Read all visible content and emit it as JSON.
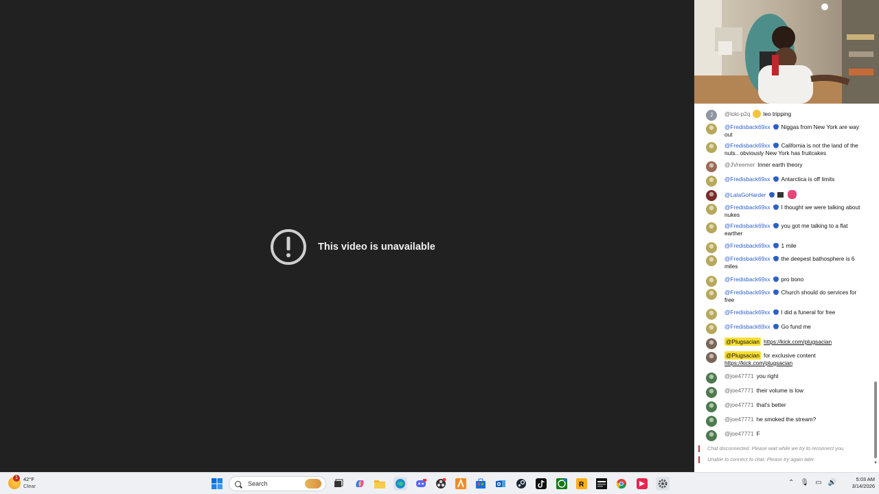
{
  "video": {
    "unavailable_message": "This video is unavailable"
  },
  "chat": {
    "messages": [
      {
        "user": "@loki-p2q",
        "text": "leo tripping",
        "style": "plain",
        "avatar": "J",
        "emoji": "laughing"
      },
      {
        "user": "@Fredisback69xx",
        "text": "Niggas from New York are way out",
        "style": "verified"
      },
      {
        "user": "@Fredisback69xx",
        "text": "California is not the land of the nuts.. obviously New York has fruitcakes",
        "style": "verified"
      },
      {
        "user": "@JVreemer",
        "text": "Inner earth theory",
        "style": "plain"
      },
      {
        "user": "@Fredisback69xx",
        "text": "Antarctica is off limits",
        "style": "verified"
      },
      {
        "user": "@LalaGoHarder",
        "text": "",
        "style": "verified",
        "emoji": "waving-hand"
      },
      {
        "user": "@Fredisback69xx",
        "text": "I thought we were talking about nukes",
        "style": "verified"
      },
      {
        "user": "@Fredisback69xx",
        "text": "you got me talking to a flat earther",
        "style": "verified"
      },
      {
        "user": "@Fredisback69xx",
        "text": "1 mile",
        "style": "verified"
      },
      {
        "user": "@Fredisback69xx",
        "text": "the deepest bathosphere is 6 miles",
        "style": "verified"
      },
      {
        "user": "@Fredisback69xx",
        "text": "pro bono",
        "style": "verified"
      },
      {
        "user": "@Fredisback69xx",
        "text": "Church should do services for free",
        "style": "verified"
      },
      {
        "user": "@Fredisback69xx",
        "text": "I did a funeral for free",
        "style": "verified"
      },
      {
        "user": "@Fredisback69xx",
        "text": "Go fund me",
        "style": "verified"
      },
      {
        "user": "@Plugsacian",
        "text": "",
        "link": "https://kick.com/plugsacian",
        "style": "highlight"
      },
      {
        "user": "@Plugsacian",
        "text": "for exclusive content",
        "link": "https://kick.com/plugsacian",
        "style": "highlight"
      },
      {
        "user": "@joe47771",
        "text": "you right",
        "style": "plain"
      },
      {
        "user": "@joe47771",
        "text": "their volume is low",
        "style": "plain"
      },
      {
        "user": "@joe47771",
        "text": "that's better",
        "style": "plain"
      },
      {
        "user": "@joe47771",
        "text": "he smoked the stream?",
        "style": "plain"
      },
      {
        "user": "@joe47771",
        "text": "F",
        "style": "plain"
      }
    ],
    "system_messages": [
      "Chat disconnected. Please wait while we try to reconnect you.",
      "Unable to connect to chat. Please try again later."
    ]
  },
  "taskbar": {
    "weather": {
      "temp": "42°F",
      "condition": "Clear",
      "badge": "1"
    },
    "search_placeholder": "Search",
    "apps": [
      "start-icon",
      "task-view-icon",
      "copilot-icon",
      "file-explorer-icon",
      "edge-icon",
      "discord-icon",
      "obs-icon",
      "app-icon",
      "store-icon",
      "outlook-icon",
      "steam-icon",
      "tiktok-icon",
      "xbox-icon",
      "rockstar-icon",
      "calendar-app-icon",
      "chrome-icon",
      "capcut-icon",
      "settings-icon"
    ],
    "clock": {
      "time": "5:03 AM",
      "date": "3/14/2026"
    }
  }
}
